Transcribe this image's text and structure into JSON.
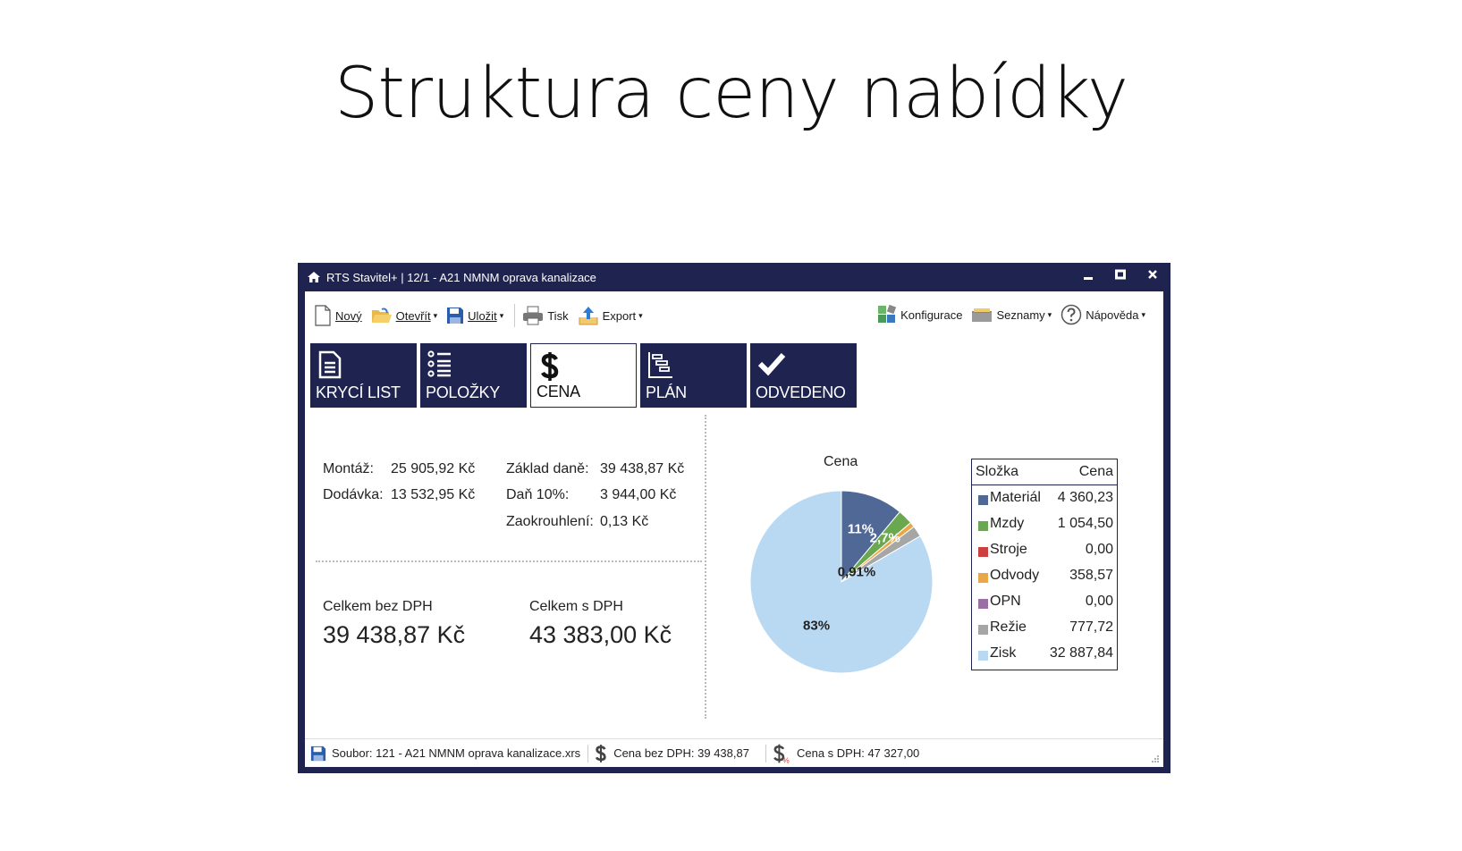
{
  "slide": {
    "title": "Struktura ceny nabídky"
  },
  "window": {
    "title": "RTS Stavitel+ | 12/1 - A21 NMNM oprava kanalizace",
    "controls": {
      "minimize": "▁",
      "maximize": "◼",
      "close": "✕"
    }
  },
  "toolbar": {
    "left": [
      {
        "label": "Nový",
        "icon": "new-document-icon",
        "dropdown": false
      },
      {
        "label": "Otevřít",
        "icon": "open-folder-icon",
        "dropdown": true
      },
      {
        "label": "Uložit",
        "icon": "save-icon",
        "dropdown": true
      },
      {
        "label": "Tisk",
        "icon": "printer-icon",
        "dropdown": false
      },
      {
        "label": "Export",
        "icon": "export-icon",
        "dropdown": true
      }
    ],
    "right": [
      {
        "label": "Konfigurace",
        "icon": "config-icon",
        "dropdown": false
      },
      {
        "label": "Seznamy",
        "icon": "lists-icon",
        "dropdown": true
      },
      {
        "label": "Nápověda",
        "icon": "help-icon",
        "dropdown": true
      }
    ],
    "caret": "▾"
  },
  "tabs": [
    {
      "label": "KRYCÍ LIST",
      "icon": "document-icon",
      "active": false
    },
    {
      "label": "POLOŽKY",
      "icon": "list-icon",
      "active": false
    },
    {
      "label": "CENA",
      "icon": "dollar-icon",
      "active": true
    },
    {
      "label": "PLÁN",
      "icon": "gantt-icon",
      "active": false
    },
    {
      "label": "ODVEDENO",
      "icon": "check-icon",
      "active": false
    }
  ],
  "summary": {
    "montaz_label": "Montáž:",
    "montaz_value": "25 905,92 Kč",
    "dodavka_label": "Dodávka:",
    "dodavka_value": "13 532,95 Kč",
    "zaklad_label": "Základ daně:",
    "zaklad_value": "39 438,87 Kč",
    "dan_label": "Daň 10%:",
    "dan_value": "3 944,00 Kč",
    "zaokr_label": "Zaokrouhlení:",
    "zaokr_value": "0,13 Kč",
    "bez_dph_label": "Celkem bez DPH",
    "bez_dph_value": "39 438,87 Kč",
    "s_dph_label": "Celkem s DPH",
    "s_dph_value": "43 383,00 Kč"
  },
  "chart_data": {
    "type": "pie",
    "title": "Cena",
    "categories": [
      "Materiál",
      "Mzdy",
      "Stroje",
      "Odvody",
      "OPN",
      "Režie",
      "Zisk"
    ],
    "values": [
      4360.23,
      1054.5,
      0.0,
      358.57,
      0.0,
      777.72,
      32887.84
    ],
    "value_labels": [
      "4 360,23",
      "1 054,50",
      "0,00",
      "358,57",
      "0,00",
      "777,72",
      "32 887,84"
    ],
    "colors": [
      "#4f6896",
      "#6aa84f",
      "#cc4040",
      "#e8a84a",
      "#9b6fa6",
      "#a6a6a6",
      "#b9d9f2"
    ],
    "slice_labels": [
      "11%",
      "2,7%",
      "",
      "",
      "",
      "0,91%",
      "83%"
    ],
    "legend": {
      "placement": "right",
      "header_name": "Složka",
      "header_value": "Cena"
    }
  },
  "statusbar": {
    "file": "Soubor: 121 - A21 NMNM oprava kanalizace.xrs",
    "price_no_vat": "Cena bez DPH:  39 438,87",
    "price_vat": "Cena s DPH:  47 327,00"
  }
}
